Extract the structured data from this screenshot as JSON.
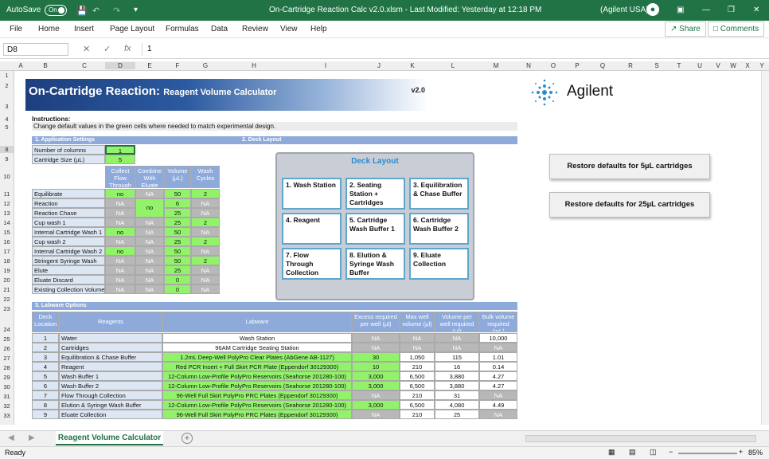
{
  "titlebar": {
    "autosave": "AutoSave",
    "toggle": "On",
    "title": "On-Cartridge Reaction Calc v2.0.xlsm  -  Last Modified: Yesterday at 12:18 PM",
    "account": "(Agilent USA)"
  },
  "menu": [
    "File",
    "Home",
    "Insert",
    "Page Layout",
    "Formulas",
    "Data",
    "Review",
    "View",
    "Help"
  ],
  "share": "Share",
  "comments": "Comments",
  "formula": {
    "namebox": "D8",
    "fx": "fx",
    "value": "1"
  },
  "columns": [
    "A",
    "B",
    "C",
    "D",
    "E",
    "F",
    "G",
    "H",
    "I",
    "J",
    "K",
    "L",
    "M",
    "N",
    "O",
    "P",
    "Q",
    "R",
    "S",
    "T",
    "U",
    "V",
    "W",
    "X",
    "Y"
  ],
  "rows": [
    "1",
    "2",
    "3",
    "4",
    "5",
    "8",
    "9",
    "10",
    "11",
    "12",
    "13",
    "14",
    "15",
    "16",
    "17",
    "18",
    "19",
    "20",
    "21",
    "22",
    "23",
    "24",
    "25",
    "26",
    "27",
    "28",
    "29",
    "30",
    "31",
    "32",
    "33"
  ],
  "banner": {
    "title": "On-Cartridge Reaction:",
    "subtitle": "Reagent Volume Calculator",
    "version": "v2.0"
  },
  "logo": "Agilent",
  "instructions": {
    "title": "Instructions:",
    "text": "Change default values in the green cells where needed to match experimental design."
  },
  "sections": {
    "s1": "1. Application Settings",
    "s2": "2. Deck Layout",
    "s3": "3. Labware Options"
  },
  "settings": [
    {
      "label": "Number of columns",
      "value": "1"
    },
    {
      "label": "Cartridge Size (µL)",
      "value": "5"
    }
  ],
  "steps_header": [
    "Collect Flow Through",
    "Combine With Eluate",
    "Volume (µL)",
    "Wash Cycles"
  ],
  "steps": [
    {
      "label": "Equilibrate",
      "c1": "no",
      "c2": "NA",
      "vol": "50",
      "wash": "2"
    },
    {
      "label": "Reaction",
      "c1": "NA",
      "c2": "no",
      "vol": "6",
      "wash": "NA"
    },
    {
      "label": "Reaction Chase",
      "c1": "NA",
      "c2": "",
      "vol": "25",
      "wash": "NA"
    },
    {
      "label": "Cup wash 1",
      "c1": "NA",
      "c2": "NA",
      "vol": "25",
      "wash": "2"
    },
    {
      "label": "Internal Cartridge Wash 1",
      "c1": "no",
      "c2": "NA",
      "vol": "50",
      "wash": "NA"
    },
    {
      "label": "Cup wash 2",
      "c1": "NA",
      "c2": "NA",
      "vol": "25",
      "wash": "2"
    },
    {
      "label": "Internal Cartridge Wash 2",
      "c1": "no",
      "c2": "NA",
      "vol": "50",
      "wash": "NA"
    },
    {
      "label": "Stringent Syringe Wash",
      "c1": "NA",
      "c2": "NA",
      "vol": "50",
      "wash": "2"
    },
    {
      "label": "Elute",
      "c1": "NA",
      "c2": "NA",
      "vol": "25",
      "wash": "NA"
    },
    {
      "label": "Eluate Discard",
      "c1": "NA",
      "c2": "NA",
      "vol": "0",
      "wash": "NA"
    },
    {
      "label": "Existing Collection Volume",
      "c1": "NA",
      "c2": "NA",
      "vol": "0",
      "wash": "NA"
    }
  ],
  "deck": {
    "title": "Deck Layout",
    "slots": [
      "1. Wash Station",
      "2. Seating Station + Cartridges",
      "3. Equilibration & Chase Buffer",
      "4. Reagent",
      "5. Cartridge Wash Buffer 1",
      "6. Cartridge Wash Buffer 2",
      "7. Flow Through Collection",
      "8. Elution & Syringe Wash Buffer",
      "9. Eluate Collection"
    ]
  },
  "buttons": {
    "restore5": "Restore defaults for 5µL cartridges",
    "restore25": "Restore defaults for 25µL cartridges"
  },
  "labware_header": [
    "Deck Location",
    "Reagents",
    "Labware",
    "Excess required per well (µl)",
    "Max well volume (µl)",
    "Volume per well required (µl)",
    "Bulk volume required (mL)"
  ],
  "labware": [
    {
      "loc": "1",
      "reagent": "Water",
      "labware": "Wash Station",
      "excess": "NA",
      "max": "NA",
      "vol": "NA",
      "bulk": "10,000"
    },
    {
      "loc": "2",
      "reagent": "Cartridges",
      "labware": "96AM Cartridge Seating Station",
      "excess": "NA",
      "max": "NA",
      "vol": "NA",
      "bulk": "NA"
    },
    {
      "loc": "3",
      "reagent": "Equilibration & Chase Buffer",
      "labware": "1.2mL Deep-Well PolyPro Clear Plates (AbGene AB-1127)",
      "excess": "30",
      "max": "1,050",
      "vol": "115",
      "bulk": "1.01"
    },
    {
      "loc": "4",
      "reagent": "Reagent",
      "labware": "Red PCR Insert + Full Skirt PCR Plate (Eppendorf 30129300)",
      "excess": "10",
      "max": "210",
      "vol": "16",
      "bulk": "0.14"
    },
    {
      "loc": "5",
      "reagent": "Wash Buffer 1",
      "labware": "12-Column Low-Profile PolyPro Reservoirs (Seahorse 201280-100)",
      "excess": "3,000",
      "max": "6,500",
      "vol": "3,880",
      "bulk": "4.27"
    },
    {
      "loc": "6",
      "reagent": "Wash Buffer 2",
      "labware": "12-Column Low-Profile PolyPro Reservoirs (Seahorse 201280-100)",
      "excess": "3,000",
      "max": "6,500",
      "vol": "3,880",
      "bulk": "4.27"
    },
    {
      "loc": "7",
      "reagent": "Flow Through Collection",
      "labware": "96-Well Full Skirt PolyPro PRC Plates (Eppendorf 30129300)",
      "excess": "NA",
      "max": "210",
      "vol": "31",
      "bulk": "NA"
    },
    {
      "loc": "8",
      "reagent": "Elution & Syringe Wash Buffer",
      "labware": "12-Column Low-Profile PolyPro Reservoirs (Seahorse 201280-100)",
      "excess": "3,000",
      "max": "6,500",
      "vol": "4,080",
      "bulk": "4.49"
    },
    {
      "loc": "9",
      "reagent": "Eluate Collection",
      "labware": "96-Well Full Skirt PolyPro PRC Plates (Eppendorf 30129300)",
      "excess": "NA",
      "max": "210",
      "vol": "25",
      "bulk": "NA"
    }
  ],
  "sheet_tab": "Reagent Volume Calculator",
  "status": {
    "ready": "Ready",
    "zoom": "85%"
  },
  "colors": {
    "excel_green": "#217346",
    "input_green": "#92f36a",
    "na_gray": "#b8b8b8",
    "header_blue": "#8eaadb"
  }
}
